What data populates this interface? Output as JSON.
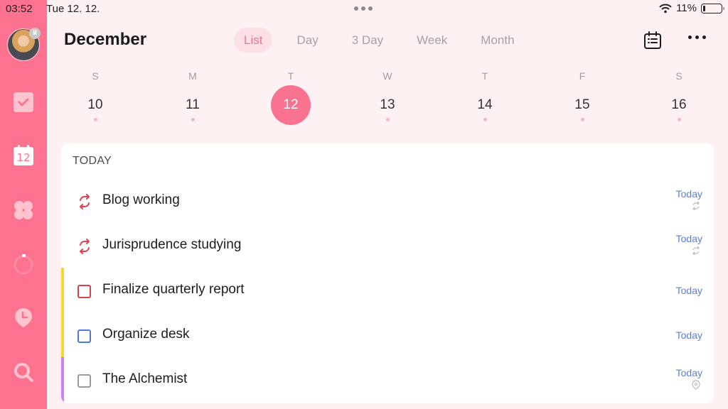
{
  "status_bar": {
    "time": "03:52",
    "date": "Tue 12. 12.",
    "battery": "11%",
    "battery_level": 0.11
  },
  "sidebar": {
    "items": [
      {
        "name": "tasks",
        "icon": "checkbox-icon"
      },
      {
        "name": "calendar",
        "icon": "calendar-icon",
        "label": "12"
      },
      {
        "name": "matrix",
        "icon": "clover-icon"
      },
      {
        "name": "pomodoro",
        "icon": "timer-ring-icon"
      },
      {
        "name": "habits",
        "icon": "clock-pin-icon"
      },
      {
        "name": "search",
        "icon": "search-icon"
      }
    ]
  },
  "header": {
    "title": "December",
    "tabs": [
      {
        "label": "List",
        "active": true
      },
      {
        "label": "Day",
        "active": false
      },
      {
        "label": "3 Day",
        "active": false
      },
      {
        "label": "Week",
        "active": false
      },
      {
        "label": "Month",
        "active": false
      }
    ]
  },
  "week": [
    {
      "dow": "S",
      "num": "10",
      "selected": false
    },
    {
      "dow": "M",
      "num": "11",
      "selected": false
    },
    {
      "dow": "T",
      "num": "12",
      "selected": true
    },
    {
      "dow": "W",
      "num": "13",
      "selected": false
    },
    {
      "dow": "T",
      "num": "14",
      "selected": false
    },
    {
      "dow": "F",
      "num": "15",
      "selected": false
    },
    {
      "dow": "S",
      "num": "16",
      "selected": false
    }
  ],
  "section": {
    "title": "TODAY",
    "tasks": [
      {
        "title": "Blog working",
        "due": "Today",
        "type": "habit",
        "check_color": "#e2424f",
        "meta": "repeat-icon"
      },
      {
        "title": "Jurisprudence studying",
        "due": "Today",
        "type": "habit",
        "check_color": "#e2424f",
        "meta": "repeat-icon"
      },
      {
        "title": "Finalize quarterly report",
        "due": "Today",
        "type": "task",
        "check_color": "#d9414c",
        "bar_color": "#fdd52e"
      },
      {
        "title": "Organize desk",
        "due": "Today",
        "type": "task",
        "check_color": "#4f78dc",
        "bar_color": "#fdd52e"
      },
      {
        "title": "The Alchemist",
        "due": "Today",
        "type": "task",
        "check_color": "#9a9a9a",
        "bar_color": "#d37ef3",
        "meta": "location-icon"
      }
    ]
  },
  "colors": {
    "accent": "#fd738f",
    "background": "#fef1f3",
    "due_text": "#5b7fd6"
  }
}
